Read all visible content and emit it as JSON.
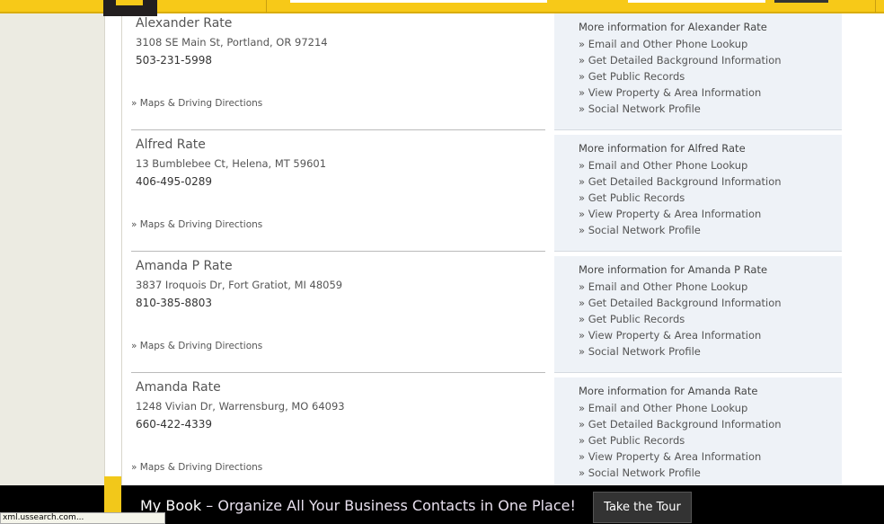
{
  "results": [
    {
      "name": "Alexander Rate",
      "address": "3108 SE Main St, Portland, OR 97214",
      "phone": "503-231-5998",
      "maps": "» Maps & Driving Directions",
      "info_title": "More information for Alexander Rate"
    },
    {
      "name": "Alfred Rate",
      "address": "13 Bumblebee Ct, Helena, MT 59601",
      "phone": "406-495-0289",
      "maps": "» Maps & Driving Directions",
      "info_title": "More information for Alfred Rate"
    },
    {
      "name": "Amanda P Rate",
      "address": "3837 Iroquois Dr, Fort Gratiot, MI 48059",
      "phone": "810-385-8803",
      "maps": "» Maps & Driving Directions",
      "info_title": "More information for Amanda P Rate"
    },
    {
      "name": "Amanda Rate",
      "address": "1248 Vivian Dr, Warrensburg, MO 64093",
      "phone": "660-422-4339",
      "maps": "» Maps & Driving Directions",
      "info_title": "More information for Amanda Rate"
    }
  ],
  "info_links": [
    "» Email and Other Phone Lookup",
    "» Get Detailed Background Information",
    "» Get Public Records",
    "» View Property & Area Information",
    "» Social Network Profile"
  ],
  "promo": {
    "brand": "My Book",
    "text": " – Organize All Your Business Contacts in One Place!",
    "button": "Take the Tour"
  },
  "status_bar": "xml.ussearch.com..."
}
